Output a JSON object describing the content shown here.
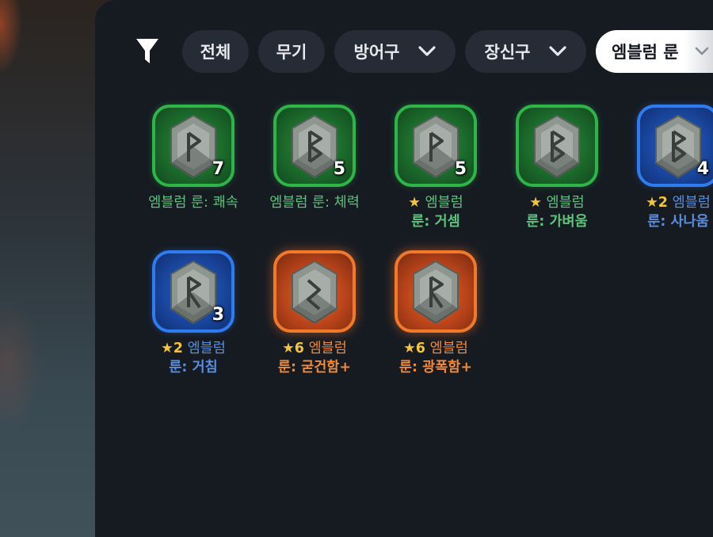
{
  "filter_bar": {
    "icon": "filter-icon",
    "chips": [
      {
        "label": "전체",
        "has_dropdown": false
      },
      {
        "label": "무기",
        "has_dropdown": false
      },
      {
        "label": "방어구",
        "has_dropdown": true
      },
      {
        "label": "장신구",
        "has_dropdown": true
      },
      {
        "label": "엠블럼 룬",
        "has_dropdown": true,
        "selected": true
      }
    ]
  },
  "colors": {
    "green_rarity": "#2fb449",
    "blue_rarity": "#2f7cf0",
    "orange_rarity": "#f07a2a",
    "star": "#f4c43c"
  },
  "items": [
    {
      "rarity": "green",
      "rune_glyph": "P",
      "count": "7",
      "star_text": "",
      "line1": "엠블럼 룬: 쾌속",
      "line2": ""
    },
    {
      "rarity": "green",
      "rune_glyph": "B",
      "count": "5",
      "star_text": "",
      "line1": "엠블럼 룬: 체력",
      "line2": ""
    },
    {
      "rarity": "green",
      "rune_glyph": "P",
      "count": "5",
      "star_text": "★",
      "line1": "엠블럼",
      "line2": "룬: 거셈"
    },
    {
      "rarity": "green",
      "rune_glyph": "B",
      "count": "",
      "star_text": "★",
      "line1": "엠블럼",
      "line2": "룬: 가벼움"
    },
    {
      "rarity": "blue",
      "rune_glyph": "B",
      "count": "4",
      "star_text": "★2",
      "line1": "엠블럼",
      "line2": "룬: 사나움"
    },
    {
      "rarity": "blue",
      "rune_glyph": "R",
      "count": "3",
      "star_text": "★2",
      "line1": "엠블럼",
      "line2": "룬: 거침"
    },
    {
      "rarity": "orange",
      "rune_glyph": "ᛋ",
      "count": "",
      "star_text": "★6",
      "line1": "엠블럼",
      "line2": "룬: 굳건함+"
    },
    {
      "rarity": "orange",
      "rune_glyph": "R",
      "count": "",
      "star_text": "★6",
      "line1": "엠블럼",
      "line2": "룬: 광폭함+"
    }
  ]
}
